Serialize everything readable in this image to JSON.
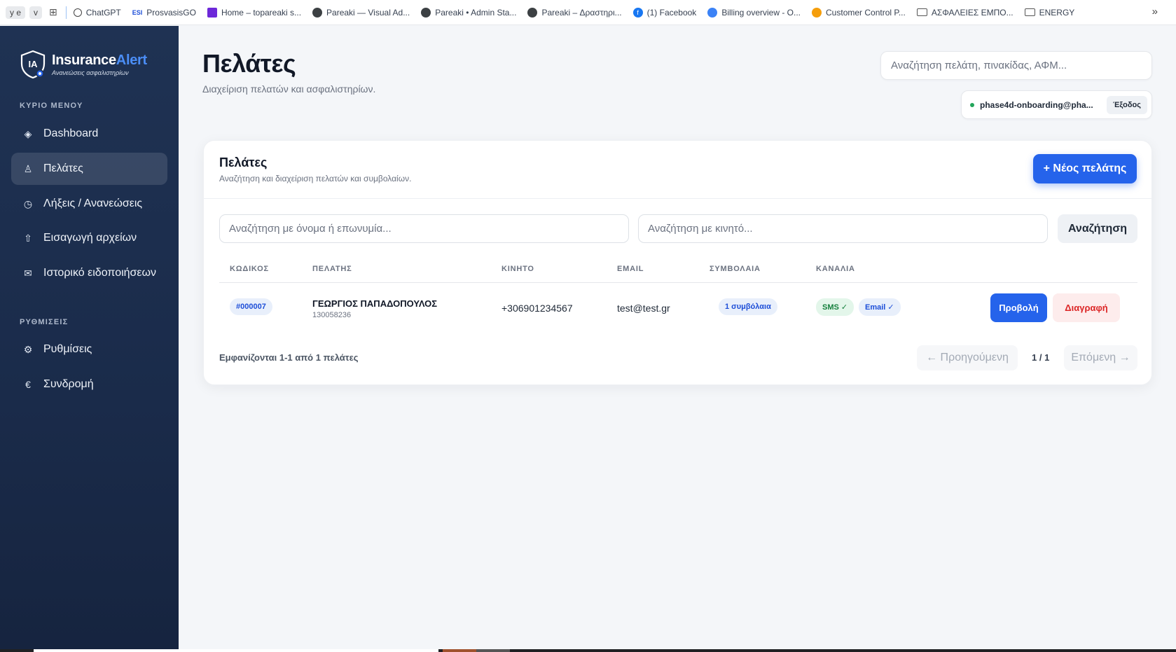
{
  "bookmarks": {
    "pill1": "y e",
    "pill2": "v",
    "items": [
      {
        "label": "ChatGPT"
      },
      {
        "icon_text": "ESI",
        "label": "ProsvasisGO"
      },
      {
        "label": "Home – topareaki s..."
      },
      {
        "label": "Pareaki — Visual Ad..."
      },
      {
        "label": "Pareaki • Admin Sta..."
      },
      {
        "label": "Pareaki – Δραστηρι..."
      },
      {
        "label": "(1) Facebook"
      },
      {
        "label": "Billing overview - O..."
      },
      {
        "label": "Customer Control P..."
      },
      {
        "label": "ΑΣΦΑΛΕΙΕΣ ΕΜΠΟ..."
      },
      {
        "label": "ENERGY"
      }
    ],
    "more": "»"
  },
  "sidebar": {
    "logo": {
      "initials": "IA",
      "title_part1": "Insurance",
      "title_part2": "Alert",
      "subtitle": "Ανανεώσεις ασφαλιστηρίων"
    },
    "section_main": "ΚΥΡΙΟ ΜΕΝΟΥ",
    "section_settings": "ΡΥΘΜΙΣΕΙΣ",
    "items": [
      {
        "icon": "◈",
        "label": "Dashboard"
      },
      {
        "icon": "♙",
        "label": "Πελάτες"
      },
      {
        "icon": "◷",
        "label": "Λήξεις / Ανανεώσεις"
      },
      {
        "icon": "⇧",
        "label": "Εισαγωγή αρχείων"
      },
      {
        "icon": "✉",
        "label": "Ιστορικό ειδοποιήσεων"
      },
      {
        "icon": "⚙",
        "label": "Ρυθμίσεις"
      },
      {
        "icon": "€",
        "label": "Συνδρομή"
      }
    ],
    "active_item": "Πελάτες"
  },
  "header": {
    "title": "Πελάτες",
    "subtitle": "Διαχείριση πελατών και ασφαλιστηρίων.",
    "search_placeholder": "Αναζήτηση πελάτη, πινακίδας, ΑΦΜ...",
    "user_email": "phase4d-onboarding@pha...",
    "logout_label": "Έξοδος"
  },
  "card": {
    "title": "Πελάτες",
    "subtitle": "Αναζήτηση και διαχείριση πελατών και συμβολαίων.",
    "new_button": "+ Νέος πελάτης",
    "search_name_placeholder": "Αναζήτηση με όνομα ή επωνυμία...",
    "search_phone_placeholder": "Αναζήτηση με κινητό...",
    "search_button": "Αναζήτηση"
  },
  "table": {
    "columns": [
      "ΚΩΔΙΚΟΣ",
      "ΠΕΛΑΤΗΣ",
      "ΚΙΝΗΤΟ",
      "EMAIL",
      "ΣΥΜΒΟΛΑΙΑ",
      "ΚΑΝΑΛΙΑ"
    ],
    "rows": [
      {
        "code": "#000007",
        "name": "ΓΕΩΡΓΙΟΣ ΠΑΠΑΔΟΠΟΥΛΟΣ",
        "tax_id": "130058236",
        "mobile": "+306901234567",
        "email": "test@test.gr",
        "contracts": "1 συμβόλαια",
        "channel_sms": "SMS ✓",
        "channel_email": "Email ✓",
        "view_label": "Προβολή",
        "delete_label": "Διαγραφή"
      }
    ]
  },
  "pagination": {
    "showing": "Εμφανίζονται 1-1 από 1 πελάτες",
    "prev": "← Προηγούμενη",
    "page": "1 / 1",
    "next": "Επόμενη →"
  },
  "colors": {
    "primary": "#2563eb",
    "sidebar_bg": "#1f3253",
    "danger": "#dc2626",
    "success": "#15803d"
  }
}
